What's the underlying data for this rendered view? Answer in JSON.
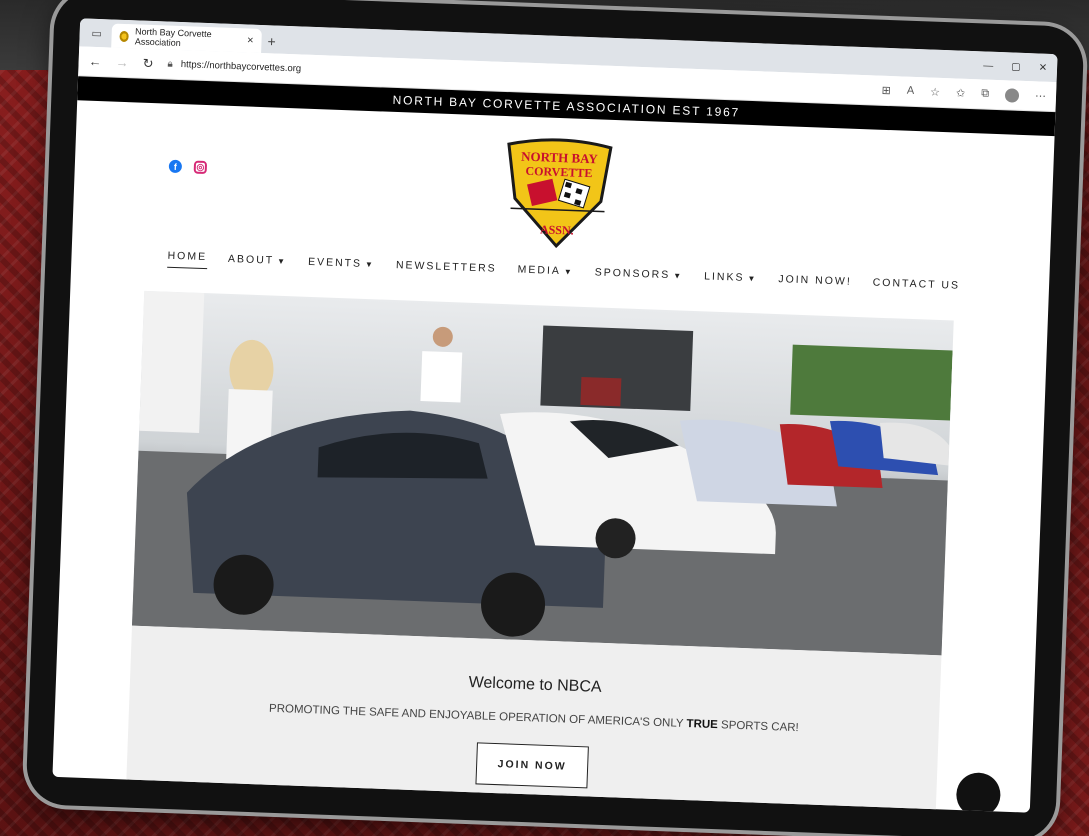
{
  "browser": {
    "tab_title": "North Bay Corvette Association",
    "tab_close": "×",
    "new_tab": "+",
    "url": "https://northbaycorvettes.org",
    "nav_back": "←",
    "nav_forward": "→",
    "nav_reload": "↻",
    "window_controls": [
      "—",
      "▢",
      "✕"
    ]
  },
  "page": {
    "announcement": "NORTH BAY CORVETTE ASSOCIATION EST 1967",
    "logo_text": [
      "NORTH BAY",
      "CORVETTE",
      "ASSN."
    ],
    "nav": [
      {
        "label": "HOME",
        "active": true,
        "dropdown": false
      },
      {
        "label": "ABOUT",
        "active": false,
        "dropdown": true
      },
      {
        "label": "EVENTS",
        "active": false,
        "dropdown": true
      },
      {
        "label": "NEWSLETTERS",
        "active": false,
        "dropdown": false
      },
      {
        "label": "MEDIA",
        "active": false,
        "dropdown": true
      },
      {
        "label": "SPONSORS",
        "active": false,
        "dropdown": true
      },
      {
        "label": "LINKS",
        "active": false,
        "dropdown": true
      },
      {
        "label": "JOIN NOW!",
        "active": false,
        "dropdown": false
      },
      {
        "label": "CONTACT US",
        "active": false,
        "dropdown": false
      }
    ],
    "welcome_title": "Welcome to NBCA",
    "tagline_pre": "PROMOTING THE SAFE AND ENJOYABLE OPERATION OF AMERICA'S ONLY ",
    "tagline_bold": "TRUE",
    "tagline_post": " SPORTS CAR!",
    "join_button": "JOIN NOW"
  },
  "icons": {
    "facebook": "facebook-icon",
    "instagram": "instagram-icon"
  },
  "colors": {
    "announce_bg": "#000000",
    "logo_yellow": "#f2c518",
    "logo_red": "#c8102e",
    "facebook": "#1877f2",
    "instagram": "#d62976"
  }
}
